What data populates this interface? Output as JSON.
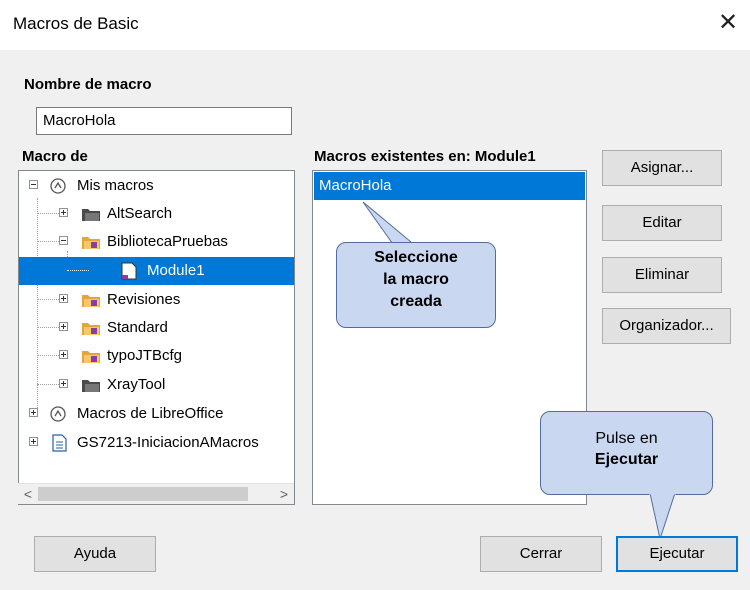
{
  "window": {
    "title": "Macros de Basic",
    "close_glyph": "✕"
  },
  "macro_name": {
    "label": "Nombre de macro",
    "value": "MacroHola"
  },
  "macro_from": {
    "label": "Macro de"
  },
  "tree": [
    {
      "label": "Mis macros",
      "icon": "macro-container-icon",
      "expanded": true
    },
    {
      "label": "AltSearch",
      "icon": "dark-folder-icon",
      "expanded": false
    },
    {
      "label": "BibliotecaPruebas",
      "icon": "folder-icon",
      "expanded": true
    },
    {
      "label": "Module1",
      "icon": "module-document-icon",
      "selected": true
    },
    {
      "label": "Revisiones",
      "icon": "folder-icon",
      "expanded": false
    },
    {
      "label": "Standard",
      "icon": "folder-icon",
      "expanded": false
    },
    {
      "label": "typoJTBcfg",
      "icon": "folder-icon",
      "expanded": false
    },
    {
      "label": "XrayTool",
      "icon": "dark-folder-icon",
      "expanded": false
    },
    {
      "label": "Macros de LibreOffice",
      "icon": "macro-container-icon",
      "expanded": false
    },
    {
      "label": "GS7213-IniciacionAMacros",
      "icon": "document-icon",
      "expanded": false
    }
  ],
  "existing": {
    "label": "Macros existentes en: Module1",
    "items": [
      "MacroHola"
    ]
  },
  "buttons": {
    "assign": "Asignar...",
    "edit": "Editar",
    "delete": "Eliminar",
    "organizer": "Organizador...",
    "help": "Ayuda",
    "close": "Cerrar",
    "run": "Ejecutar"
  },
  "callouts": {
    "select": [
      "Seleccione",
      "la macro",
      "creada"
    ],
    "run_line1": "Pulse en",
    "run_line2": "Ejecutar"
  },
  "colors": {
    "selection": "#0078d7",
    "callout_fill": "#c9d8f0",
    "callout_border": "#536c9c"
  }
}
